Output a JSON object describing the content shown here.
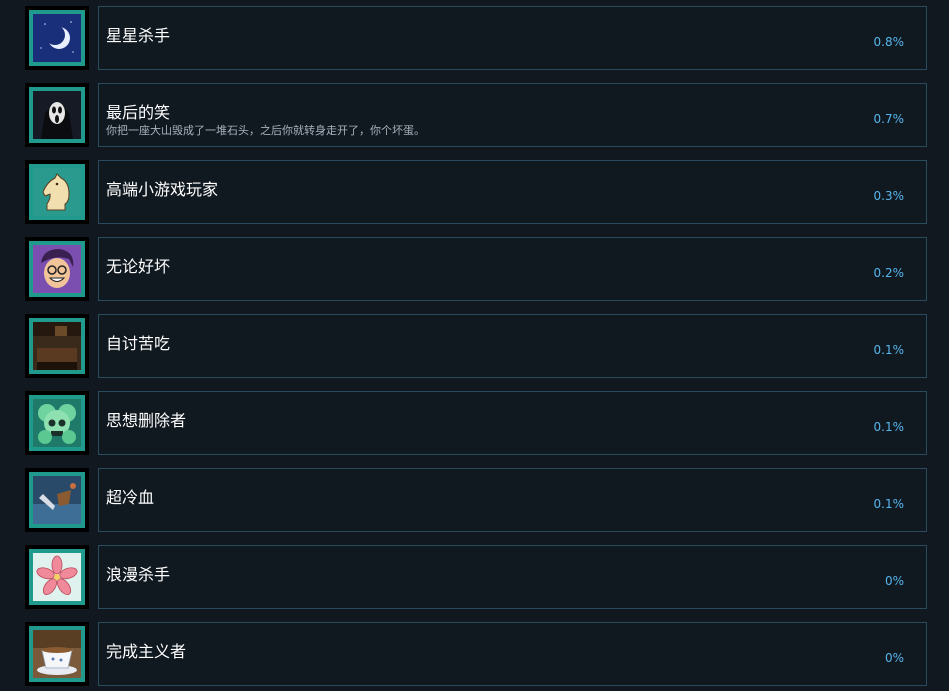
{
  "achievements": [
    {
      "title": "星星杀手",
      "description": "",
      "percent": "0.8%",
      "icon": "crescent-moon-icon"
    },
    {
      "title": "最后的笑",
      "description": "你把一座大山毁成了一堆石头，之后你就转身走开了，你个坏蛋。",
      "percent": "0.7%",
      "icon": "ghost-mask-icon"
    },
    {
      "title": "高端小游戏玩家",
      "description": "",
      "percent": "0.3%",
      "icon": "chess-knight-icon"
    },
    {
      "title": "无论好坏",
      "description": "",
      "percent": "0.2%",
      "icon": "smiling-face-icon"
    },
    {
      "title": "自讨苦吃",
      "description": "",
      "percent": "0.1%",
      "icon": "dark-room-icon"
    },
    {
      "title": "思想删除者",
      "description": "",
      "percent": "0.1%",
      "icon": "green-skull-icon"
    },
    {
      "title": "超冷血",
      "description": "",
      "percent": "0.1%",
      "icon": "sinking-ship-icon"
    },
    {
      "title": "浪漫杀手",
      "description": "",
      "percent": "0%",
      "icon": "flower-icon"
    },
    {
      "title": "完成主义者",
      "description": "",
      "percent": "0%",
      "icon": "teacup-icon"
    }
  ]
}
